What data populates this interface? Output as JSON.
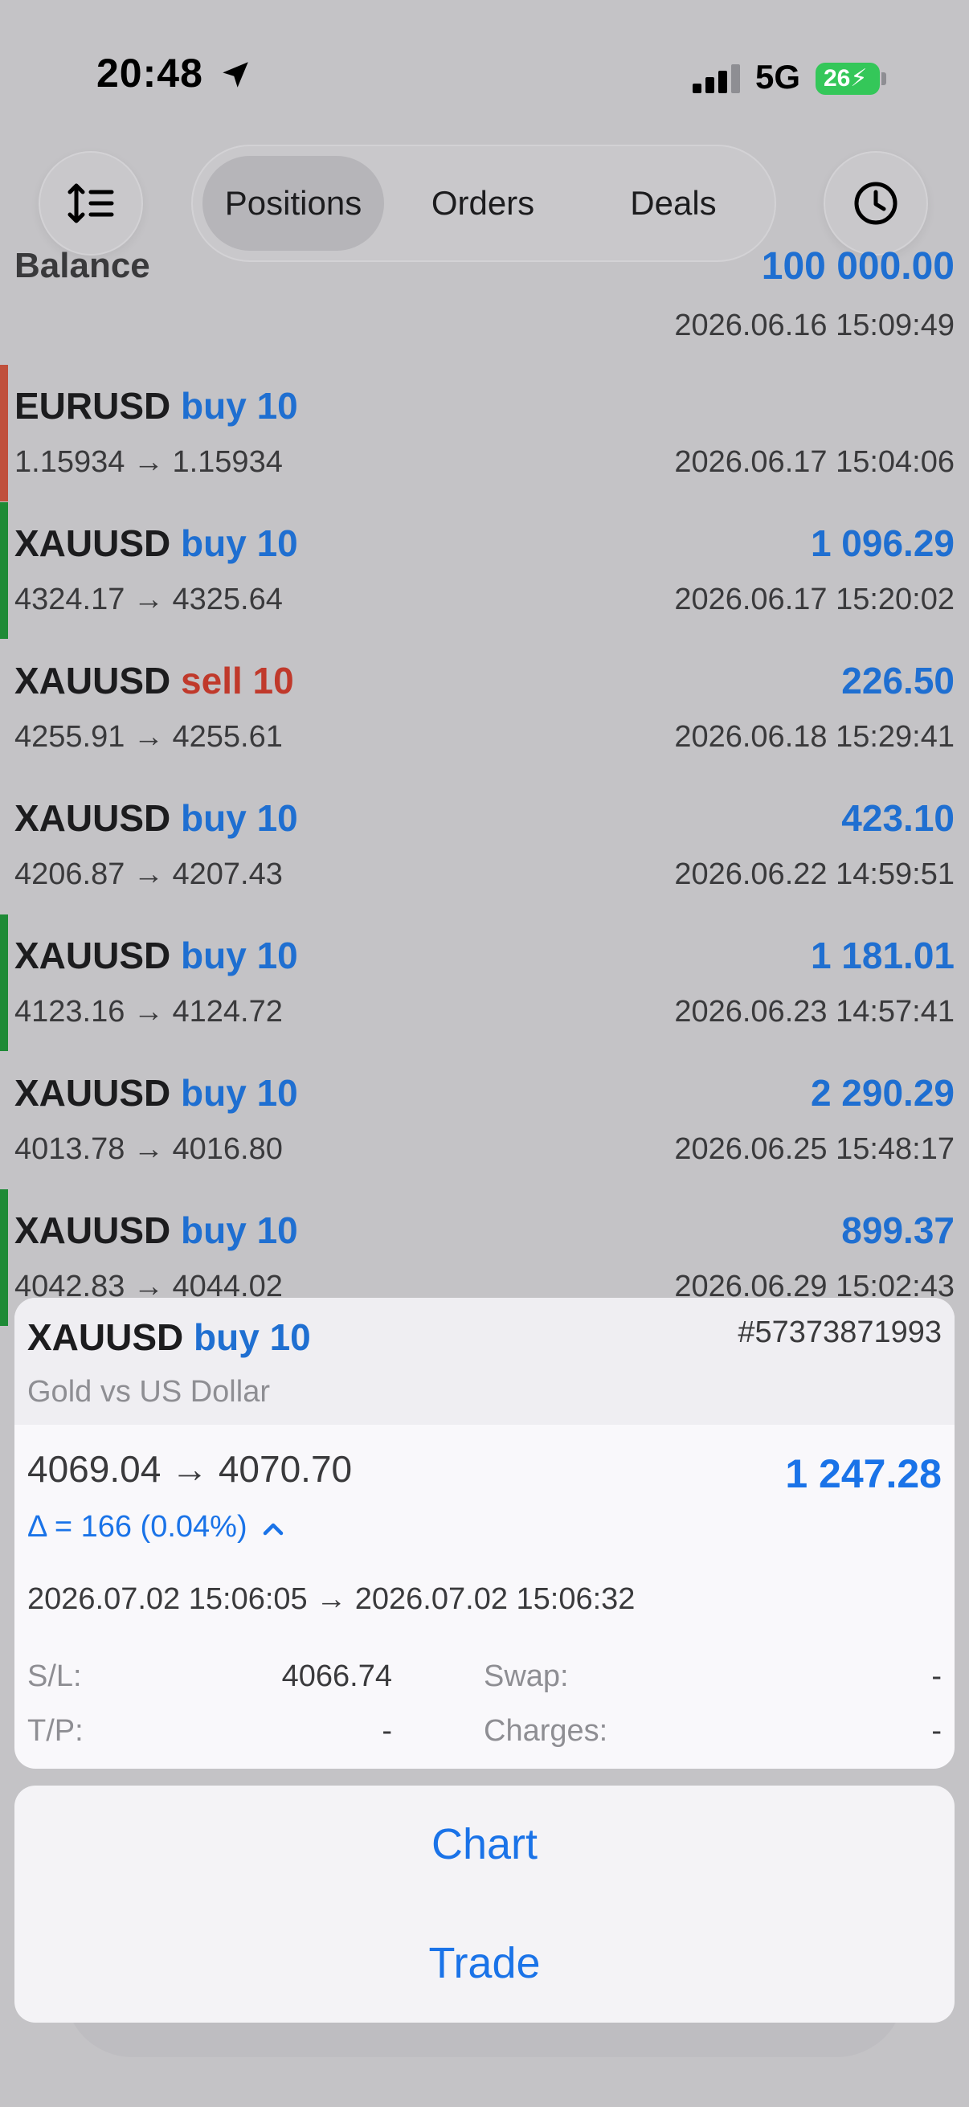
{
  "status_bar": {
    "time": "20:48",
    "network": "5G",
    "battery": "26"
  },
  "toolbar": {
    "tabs": [
      {
        "label": "Positions",
        "active": true
      },
      {
        "label": "Orders",
        "active": false
      },
      {
        "label": "Deals",
        "active": false
      }
    ],
    "left_icon": "sort-icon",
    "right_icon": "clock-icon"
  },
  "balance": {
    "label": "Balance",
    "value": "100 000.00",
    "time": "2026.06.16 15:09:49"
  },
  "positions": [
    {
      "symbol": "EURUSD",
      "side": "buy 10",
      "direction": "buy",
      "prices": "1.15934 → 1.15934",
      "profit": "",
      "time": "2026.06.17 15:04:06",
      "indicator": "#c0503c"
    },
    {
      "symbol": "XAUUSD",
      "side": "buy 10",
      "direction": "buy",
      "prices": "4324.17 → 4325.64",
      "profit": "1 096.29",
      "time": "2026.06.17 15:20:02",
      "indicator": "#1e8a36"
    },
    {
      "symbol": "XAUUSD",
      "side": "sell 10",
      "direction": "sell",
      "prices": "4255.91 → 4255.61",
      "profit": "226.50",
      "time": "2026.06.18 15:29:41",
      "indicator": ""
    },
    {
      "symbol": "XAUUSD",
      "side": "buy 10",
      "direction": "buy",
      "prices": "4206.87 → 4207.43",
      "profit": "423.10",
      "time": "2026.06.22 14:59:51",
      "indicator": ""
    },
    {
      "symbol": "XAUUSD",
      "side": "buy 10",
      "direction": "buy",
      "prices": "4123.16 → 4124.72",
      "profit": "1 181.01",
      "time": "2026.06.23 14:57:41",
      "indicator": "#1e8a36"
    },
    {
      "symbol": "XAUUSD",
      "side": "buy 10",
      "direction": "buy",
      "prices": "4013.78 → 4016.80",
      "profit": "2 290.29",
      "time": "2026.06.25 15:48:17",
      "indicator": ""
    },
    {
      "symbol": "XAUUSD",
      "side": "buy 10",
      "direction": "buy",
      "prices": "4042.83 → 4044.02",
      "profit": "899.37",
      "time": "2026.06.29 15:02:43",
      "indicator": "#1e8a36"
    }
  ],
  "detail": {
    "symbol": "XAUUSD",
    "side": "buy 10",
    "ticket": "#57373871993",
    "description": "Gold vs US Dollar",
    "prices": "4069.04 → 4070.70",
    "profit": "1 247.28",
    "delta": "Δ = 166 (0.04%)",
    "times": "2026.07.02 15:06:05 → 2026.07.02 15:06:32",
    "sl_label": "S/L:",
    "sl_value": "4066.74",
    "tp_label": "T/P:",
    "tp_value": "-",
    "swap_label": "Swap:",
    "swap_value": "-",
    "charges_label": "Charges:",
    "charges_value": "-"
  },
  "actions": {
    "chart_label": "Chart",
    "trade_label": "Trade"
  },
  "colors": {
    "accent": "#1a73e8",
    "buy": "#1f6fd1",
    "sell": "#c0392b",
    "profit_indicator": "#1e8a36",
    "loss_indicator": "#c0503c"
  }
}
